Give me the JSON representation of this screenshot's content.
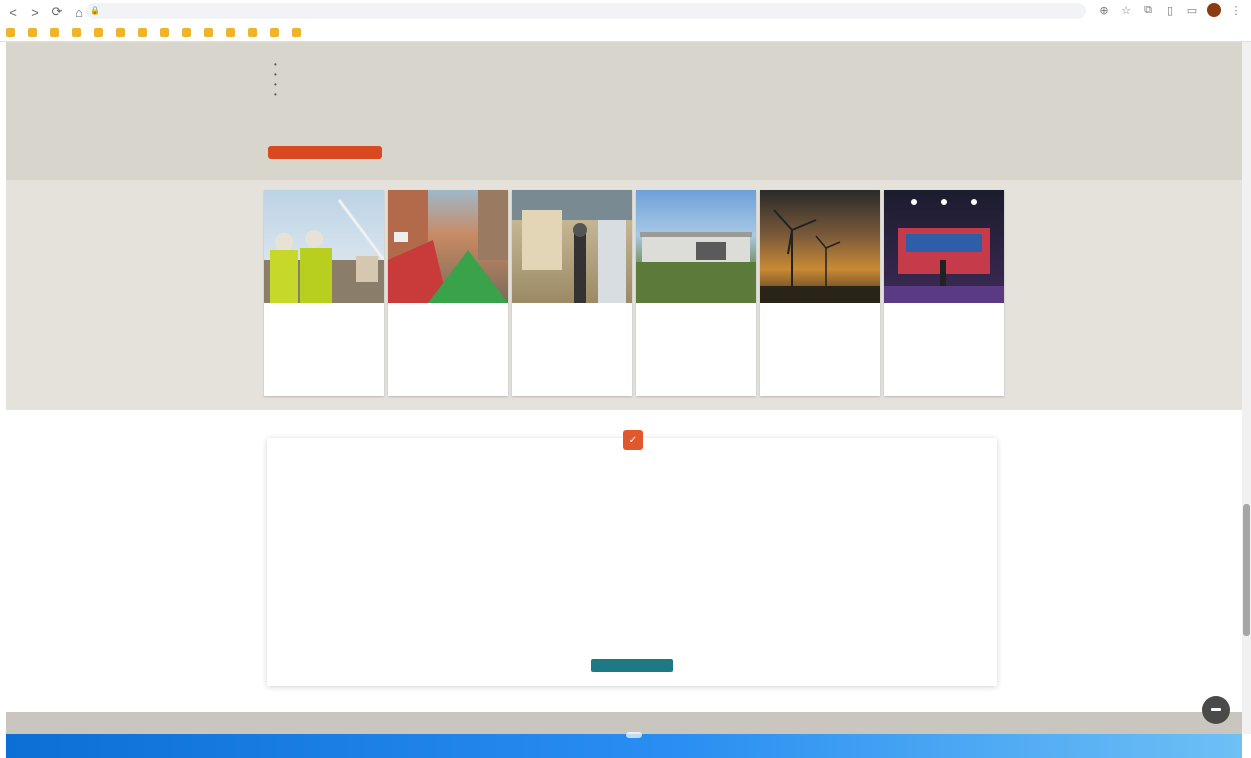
{
  "browser": {
    "nav": [
      "<",
      ">",
      "⟳",
      "⌂"
    ],
    "url": "",
    "bookmarks": [
      "",
      "",
      "",
      "",
      "",
      "",
      "",
      "",
      "",
      "",
      "",
      "",
      "",
      ""
    ]
  },
  "intro": {
    "paragraphs": [
      "",
      ""
    ],
    "bullets": [
      "",
      "",
      "",
      ""
    ],
    "cta_label": ""
  },
  "cards": [
    {
      "title": "",
      "text": "",
      "image": "construction-workers-image"
    },
    {
      "title": "",
      "text": "",
      "image": "street-bike-lane-image"
    },
    {
      "title": "",
      "text": "",
      "image": "surveyor-image"
    },
    {
      "title": "",
      "text": "",
      "image": "house-image"
    },
    {
      "title": "",
      "text": "",
      "image": "wind-turbines-image"
    },
    {
      "title": "",
      "text": "",
      "image": "stage-presentation-image"
    }
  ],
  "notice": {
    "badge": "✓",
    "title": "",
    "paragraphs": [
      "",
      "",
      "",
      "",
      ""
    ],
    "contacts": [
      {
        "head": "",
        "lines": [
          "",
          ""
        ]
      },
      {
        "head": "",
        "lines": [
          "",
          ""
        ]
      }
    ],
    "closing": "",
    "button_label": ""
  },
  "colors": {
    "accent_orange": "#d9481f",
    "teal": "#1d7a85",
    "band": "#e5e2dc",
    "taskbar": "#0b6fd6"
  }
}
